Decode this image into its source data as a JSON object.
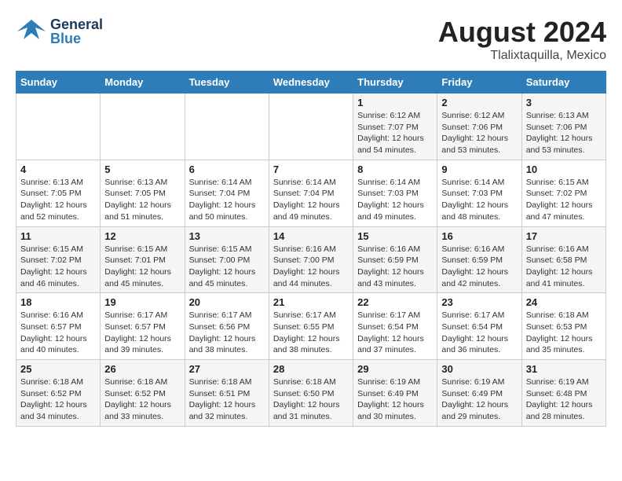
{
  "header": {
    "logo_general": "General",
    "logo_blue": "Blue",
    "month_year": "August 2024",
    "location": "Tlalixtaquilla, Mexico"
  },
  "days_of_week": [
    "Sunday",
    "Monday",
    "Tuesday",
    "Wednesday",
    "Thursday",
    "Friday",
    "Saturday"
  ],
  "weeks": [
    [
      {
        "num": "",
        "info": ""
      },
      {
        "num": "",
        "info": ""
      },
      {
        "num": "",
        "info": ""
      },
      {
        "num": "",
        "info": ""
      },
      {
        "num": "1",
        "info": "Sunrise: 6:12 AM\nSunset: 7:07 PM\nDaylight: 12 hours\nand 54 minutes."
      },
      {
        "num": "2",
        "info": "Sunrise: 6:12 AM\nSunset: 7:06 PM\nDaylight: 12 hours\nand 53 minutes."
      },
      {
        "num": "3",
        "info": "Sunrise: 6:13 AM\nSunset: 7:06 PM\nDaylight: 12 hours\nand 53 minutes."
      }
    ],
    [
      {
        "num": "4",
        "info": "Sunrise: 6:13 AM\nSunset: 7:05 PM\nDaylight: 12 hours\nand 52 minutes."
      },
      {
        "num": "5",
        "info": "Sunrise: 6:13 AM\nSunset: 7:05 PM\nDaylight: 12 hours\nand 51 minutes."
      },
      {
        "num": "6",
        "info": "Sunrise: 6:14 AM\nSunset: 7:04 PM\nDaylight: 12 hours\nand 50 minutes."
      },
      {
        "num": "7",
        "info": "Sunrise: 6:14 AM\nSunset: 7:04 PM\nDaylight: 12 hours\nand 49 minutes."
      },
      {
        "num": "8",
        "info": "Sunrise: 6:14 AM\nSunset: 7:03 PM\nDaylight: 12 hours\nand 49 minutes."
      },
      {
        "num": "9",
        "info": "Sunrise: 6:14 AM\nSunset: 7:03 PM\nDaylight: 12 hours\nand 48 minutes."
      },
      {
        "num": "10",
        "info": "Sunrise: 6:15 AM\nSunset: 7:02 PM\nDaylight: 12 hours\nand 47 minutes."
      }
    ],
    [
      {
        "num": "11",
        "info": "Sunrise: 6:15 AM\nSunset: 7:02 PM\nDaylight: 12 hours\nand 46 minutes."
      },
      {
        "num": "12",
        "info": "Sunrise: 6:15 AM\nSunset: 7:01 PM\nDaylight: 12 hours\nand 45 minutes."
      },
      {
        "num": "13",
        "info": "Sunrise: 6:15 AM\nSunset: 7:00 PM\nDaylight: 12 hours\nand 45 minutes."
      },
      {
        "num": "14",
        "info": "Sunrise: 6:16 AM\nSunset: 7:00 PM\nDaylight: 12 hours\nand 44 minutes."
      },
      {
        "num": "15",
        "info": "Sunrise: 6:16 AM\nSunset: 6:59 PM\nDaylight: 12 hours\nand 43 minutes."
      },
      {
        "num": "16",
        "info": "Sunrise: 6:16 AM\nSunset: 6:59 PM\nDaylight: 12 hours\nand 42 minutes."
      },
      {
        "num": "17",
        "info": "Sunrise: 6:16 AM\nSunset: 6:58 PM\nDaylight: 12 hours\nand 41 minutes."
      }
    ],
    [
      {
        "num": "18",
        "info": "Sunrise: 6:16 AM\nSunset: 6:57 PM\nDaylight: 12 hours\nand 40 minutes."
      },
      {
        "num": "19",
        "info": "Sunrise: 6:17 AM\nSunset: 6:57 PM\nDaylight: 12 hours\nand 39 minutes."
      },
      {
        "num": "20",
        "info": "Sunrise: 6:17 AM\nSunset: 6:56 PM\nDaylight: 12 hours\nand 38 minutes."
      },
      {
        "num": "21",
        "info": "Sunrise: 6:17 AM\nSunset: 6:55 PM\nDaylight: 12 hours\nand 38 minutes."
      },
      {
        "num": "22",
        "info": "Sunrise: 6:17 AM\nSunset: 6:54 PM\nDaylight: 12 hours\nand 37 minutes."
      },
      {
        "num": "23",
        "info": "Sunrise: 6:17 AM\nSunset: 6:54 PM\nDaylight: 12 hours\nand 36 minutes."
      },
      {
        "num": "24",
        "info": "Sunrise: 6:18 AM\nSunset: 6:53 PM\nDaylight: 12 hours\nand 35 minutes."
      }
    ],
    [
      {
        "num": "25",
        "info": "Sunrise: 6:18 AM\nSunset: 6:52 PM\nDaylight: 12 hours\nand 34 minutes."
      },
      {
        "num": "26",
        "info": "Sunrise: 6:18 AM\nSunset: 6:52 PM\nDaylight: 12 hours\nand 33 minutes."
      },
      {
        "num": "27",
        "info": "Sunrise: 6:18 AM\nSunset: 6:51 PM\nDaylight: 12 hours\nand 32 minutes."
      },
      {
        "num": "28",
        "info": "Sunrise: 6:18 AM\nSunset: 6:50 PM\nDaylight: 12 hours\nand 31 minutes."
      },
      {
        "num": "29",
        "info": "Sunrise: 6:19 AM\nSunset: 6:49 PM\nDaylight: 12 hours\nand 30 minutes."
      },
      {
        "num": "30",
        "info": "Sunrise: 6:19 AM\nSunset: 6:49 PM\nDaylight: 12 hours\nand 29 minutes."
      },
      {
        "num": "31",
        "info": "Sunrise: 6:19 AM\nSunset: 6:48 PM\nDaylight: 12 hours\nand 28 minutes."
      }
    ]
  ]
}
